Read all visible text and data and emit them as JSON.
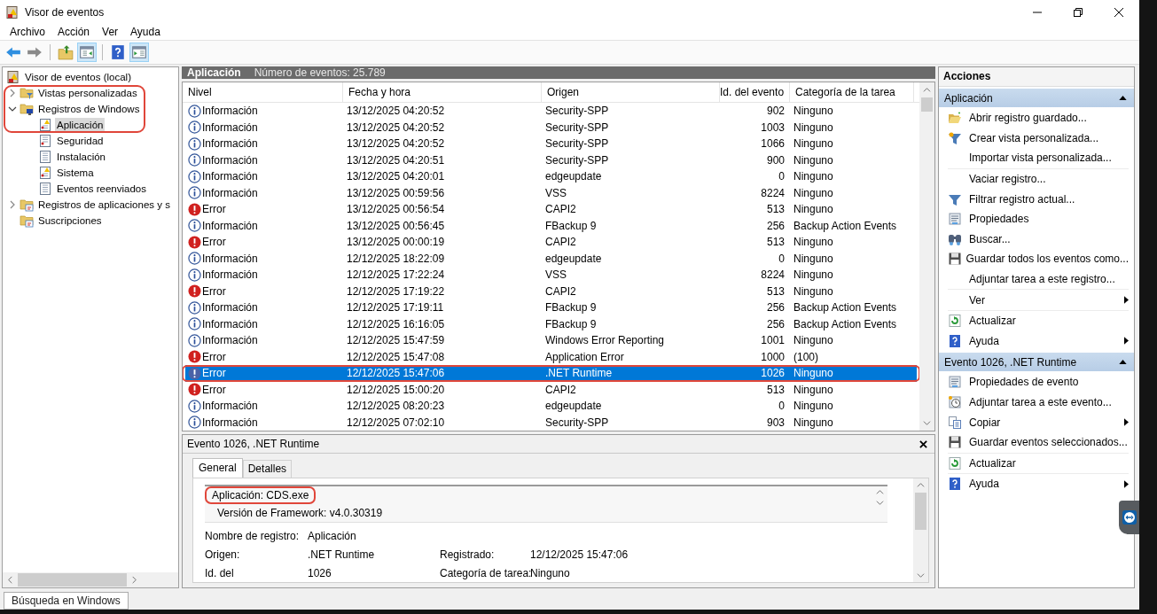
{
  "window": {
    "title": "Visor de eventos"
  },
  "menu": [
    "Archivo",
    "Acción",
    "Ver",
    "Ayuda"
  ],
  "tree": {
    "label": "Visor de eventos (local)",
    "selected": false,
    "children": [
      {
        "label": "Vistas personalizadas",
        "expanded": false,
        "selected": false
      },
      {
        "label": "Registros de Windows",
        "expanded": true,
        "selected": false,
        "children": [
          {
            "label": "Aplicación",
            "selected": true
          },
          {
            "label": "Seguridad",
            "selected": false
          },
          {
            "label": "Instalación",
            "selected": false
          },
          {
            "label": "Sistema",
            "selected": false
          },
          {
            "label": "Eventos reenviados",
            "selected": false
          }
        ]
      },
      {
        "label": "Registros de aplicaciones y s",
        "expanded": false,
        "selected": false
      },
      {
        "label": "Suscripciones",
        "selected": false
      }
    ]
  },
  "list_header": {
    "log": "Aplicación",
    "count": "Número de eventos: 25.789"
  },
  "table": {
    "columns": [
      "Nivel",
      "Fecha y hora",
      "Origen",
      "Id. del evento",
      "Categoría de la tarea"
    ],
    "rows": [
      {
        "kind": "info",
        "severity": "Información",
        "date": "13/12/2025 04:20:52",
        "source": "Security-SPP",
        "event_id": "902",
        "category": "Ninguno",
        "selected": false
      },
      {
        "kind": "info",
        "severity": "Información",
        "date": "13/12/2025 04:20:52",
        "source": "Security-SPP",
        "event_id": "1003",
        "category": "Ninguno",
        "selected": false
      },
      {
        "kind": "info",
        "severity": "Información",
        "date": "13/12/2025 04:20:52",
        "source": "Security-SPP",
        "event_id": "1066",
        "category": "Ninguno",
        "selected": false
      },
      {
        "kind": "info",
        "severity": "Información",
        "date": "13/12/2025 04:20:51",
        "source": "Security-SPP",
        "event_id": "900",
        "category": "Ninguno",
        "selected": false
      },
      {
        "kind": "info",
        "severity": "Información",
        "date": "13/12/2025 04:20:01",
        "source": "edgeupdate",
        "event_id": "0",
        "category": "Ninguno",
        "selected": false
      },
      {
        "kind": "info",
        "severity": "Información",
        "date": "13/12/2025 00:59:56",
        "source": "VSS",
        "event_id": "8224",
        "category": "Ninguno",
        "selected": false
      },
      {
        "kind": "error",
        "severity": "Error",
        "date": "13/12/2025 00:56:54",
        "source": "CAPI2",
        "event_id": "513",
        "category": "Ninguno",
        "selected": false
      },
      {
        "kind": "info",
        "severity": "Información",
        "date": "13/12/2025 00:56:45",
        "source": "FBackup 9",
        "event_id": "256",
        "category": "Backup Action Events",
        "selected": false
      },
      {
        "kind": "error",
        "severity": "Error",
        "date": "13/12/2025 00:00:19",
        "source": "CAPI2",
        "event_id": "513",
        "category": "Ninguno",
        "selected": false
      },
      {
        "kind": "info",
        "severity": "Información",
        "date": "12/12/2025 18:22:09",
        "source": "edgeupdate",
        "event_id": "0",
        "category": "Ninguno",
        "selected": false
      },
      {
        "kind": "info",
        "severity": "Información",
        "date": "12/12/2025 17:22:24",
        "source": "VSS",
        "event_id": "8224",
        "category": "Ninguno",
        "selected": false
      },
      {
        "kind": "error",
        "severity": "Error",
        "date": "12/12/2025 17:19:22",
        "source": "CAPI2",
        "event_id": "513",
        "category": "Ninguno",
        "selected": false
      },
      {
        "kind": "info",
        "severity": "Información",
        "date": "12/12/2025 17:19:11",
        "source": "FBackup 9",
        "event_id": "256",
        "category": "Backup Action Events",
        "selected": false
      },
      {
        "kind": "info",
        "severity": "Información",
        "date": "12/12/2025 16:16:05",
        "source": "FBackup 9",
        "event_id": "256",
        "category": "Backup Action Events",
        "selected": false
      },
      {
        "kind": "info",
        "severity": "Información",
        "date": "12/12/2025 15:47:59",
        "source": "Windows Error Reporting",
        "event_id": "1001",
        "category": "Ninguno",
        "selected": false
      },
      {
        "kind": "error",
        "severity": "Error",
        "date": "12/12/2025 15:47:08",
        "source": "Application Error",
        "event_id": "1000",
        "category": "(100)",
        "selected": false
      },
      {
        "kind": "error",
        "severity": "Error",
        "date": "12/12/2025 15:47:06",
        "source": ".NET Runtime",
        "event_id": "1026",
        "category": "Ninguno",
        "selected": true
      },
      {
        "kind": "error",
        "severity": "Error",
        "date": "12/12/2025 15:00:20",
        "source": "CAPI2",
        "event_id": "513",
        "category": "Ninguno",
        "selected": false
      },
      {
        "kind": "info",
        "severity": "Información",
        "date": "12/12/2025 08:20:23",
        "source": "edgeupdate",
        "event_id": "0",
        "category": "Ninguno",
        "selected": false
      },
      {
        "kind": "info",
        "severity": "Información",
        "date": "12/12/2025 07:02:10",
        "source": "Security-SPP",
        "event_id": "903",
        "category": "Ninguno",
        "selected": false
      }
    ]
  },
  "detail": {
    "title": "Evento 1026, .NET Runtime",
    "tabs": [
      {
        "label": "General",
        "selected": true
      },
      {
        "label": "Detalles",
        "selected": false
      }
    ],
    "description": [
      "Aplicación: CDS.exe",
      "Versión de Framework: v4.0.30319"
    ],
    "fields": [
      [
        {
          "label": "Nombre de registro:",
          "value": "Aplicación"
        }
      ],
      [
        {
          "label": "Origen:",
          "value": ".NET Runtime"
        },
        {
          "label": "Registrado:",
          "value": "12/12/2025 15:47:06"
        }
      ],
      [
        {
          "label": "Id. del",
          "value": "1026"
        },
        {
          "label": "Categoría de tarea:",
          "value": "Ninguno"
        }
      ]
    ]
  },
  "actions": {
    "title": "Acciones",
    "sections": [
      {
        "title": "Aplicación",
        "expanded": true,
        "groups": [
          [
            {
              "label": "Abrir registro guardado...",
              "submenu": false
            },
            {
              "label": "Crear vista personalizada...",
              "submenu": false
            },
            {
              "label": "Importar vista personalizada...",
              "submenu": false
            }
          ],
          [
            {
              "label": "Vaciar registro...",
              "submenu": false
            },
            {
              "label": "Filtrar registro actual...",
              "submenu": false
            },
            {
              "label": "Propiedades",
              "submenu": false
            },
            {
              "label": "Buscar...",
              "submenu": false
            },
            {
              "label": "Guardar todos los eventos como...",
              "submenu": false
            },
            {
              "label": "Adjuntar tarea a este registro...",
              "submenu": false
            }
          ],
          [
            {
              "label": "Ver",
              "submenu": true
            }
          ],
          [
            {
              "label": "Actualizar",
              "submenu": false
            },
            {
              "label": "Ayuda",
              "submenu": true
            }
          ]
        ]
      },
      {
        "title": "Evento 1026, .NET Runtime",
        "expanded": true,
        "groups": [
          [
            {
              "label": "Propiedades de evento",
              "submenu": false
            },
            {
              "label": "Adjuntar tarea a este evento...",
              "submenu": false
            },
            {
              "label": "Copiar",
              "submenu": true
            },
            {
              "label": "Guardar eventos seleccionados...",
              "submenu": false
            }
          ],
          [
            {
              "label": "Actualizar",
              "submenu": false
            }
          ],
          [
            {
              "label": "Ayuda",
              "submenu": true
            }
          ]
        ]
      }
    ]
  },
  "status_bar": {
    "search_label": "Búsqueda en Windows"
  }
}
